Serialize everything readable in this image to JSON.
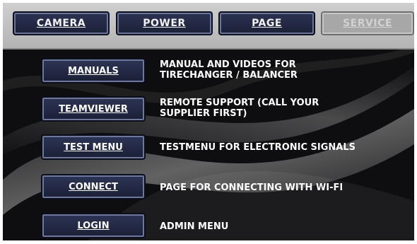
{
  "tabs": [
    {
      "label": "CAMERA",
      "active": true
    },
    {
      "label": "POWER",
      "active": true
    },
    {
      "label": "PAGE",
      "active": true
    },
    {
      "label": "SERVICE",
      "active": false
    }
  ],
  "menu": [
    {
      "button": "MANUALS",
      "description": "MANUAL AND VIDEOS FOR\nTIRECHANGER / BALANCER"
    },
    {
      "button": "TEAMVIEWER",
      "description": "REMOTE SUPPORT (CALL YOUR\nSUPPLIER FIRST)"
    },
    {
      "button": "TEST MENU",
      "description": "TESTMENU FOR ELECTRONIC SIGNALS"
    },
    {
      "button": "CONNECT",
      "description": "PAGE FOR CONNECTING WITH WI-FI"
    },
    {
      "button": "LOGIN",
      "description": "ADMIN MENU"
    }
  ],
  "colors": {
    "button_fill": "#1f2440",
    "button_border": "#6f789c",
    "topbar": "#c2c2c2",
    "background": "#0e0e10",
    "text": "#ffffff"
  }
}
